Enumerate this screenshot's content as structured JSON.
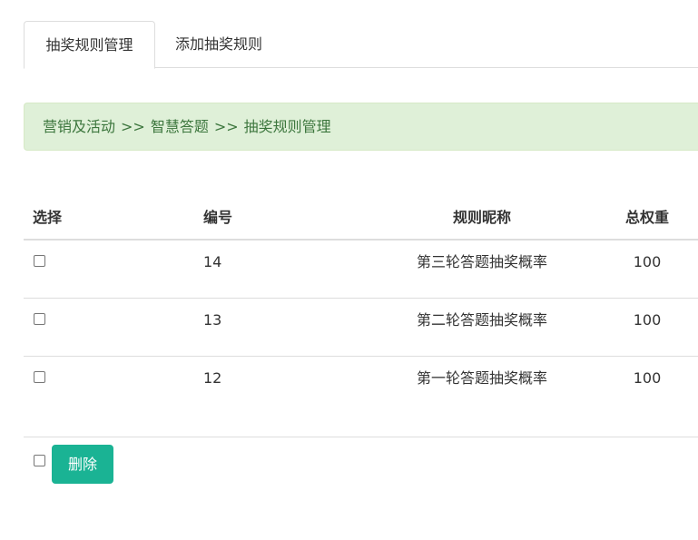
{
  "tabs": [
    {
      "label": "抽奖规则管理",
      "active": true
    },
    {
      "label": "添加抽奖规则",
      "active": false
    }
  ],
  "breadcrumb": {
    "items": [
      "营销及活动",
      "智慧答题",
      "抽奖规则管理"
    ],
    "separator": ">>"
  },
  "table": {
    "headers": {
      "select": "选择",
      "id": "编号",
      "name": "规则昵称",
      "weight": "总权重"
    },
    "rows": [
      {
        "id": "14",
        "name": "第三轮答题抽奖概率",
        "weight": "100"
      },
      {
        "id": "13",
        "name": "第二轮答题抽奖概率",
        "weight": "100"
      },
      {
        "id": "12",
        "name": "第一轮答题抽奖概率",
        "weight": "100"
      }
    ]
  },
  "actions": {
    "delete_label": "删除"
  },
  "colors": {
    "accent": "#1ab394",
    "alert_bg": "#dff0d8",
    "alert_text": "#3c763d"
  }
}
